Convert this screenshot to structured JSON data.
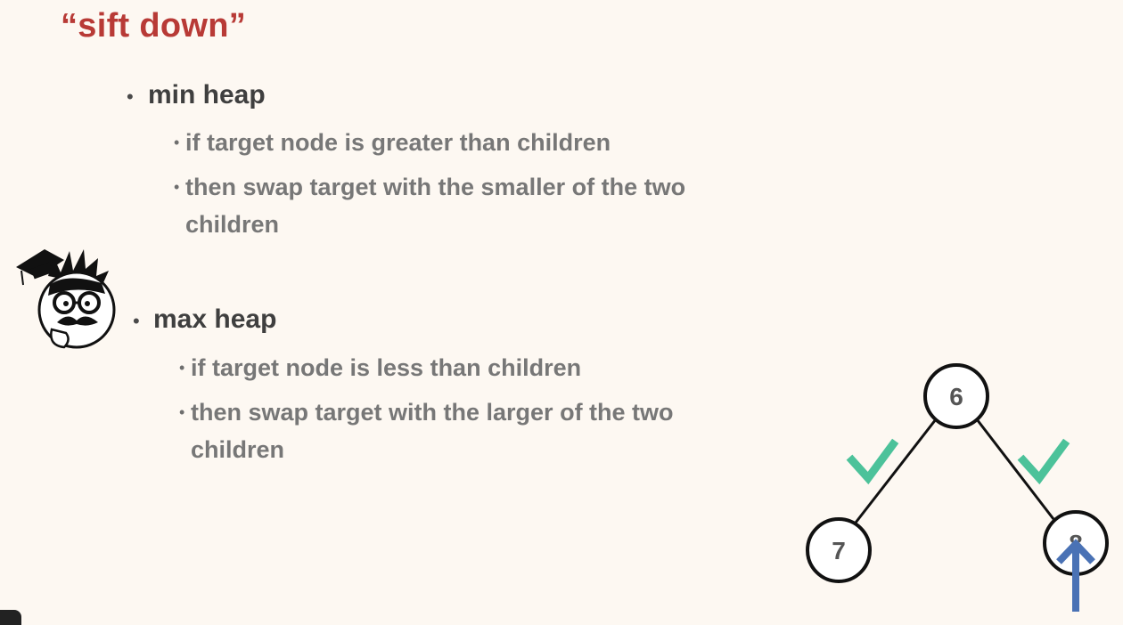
{
  "title": "“sift down”",
  "sections": [
    {
      "heading": "min heap",
      "items": [
        "if target node is greater than children",
        "then swap target with the smaller of the two children"
      ]
    },
    {
      "heading": "max heap",
      "items": [
        "if target node is less than children",
        "then swap target with the larger of the two children"
      ]
    }
  ],
  "tree": {
    "root": "6",
    "left": "7",
    "right": "8"
  },
  "colors": {
    "title": "#b83a36",
    "check": "#4cc29a",
    "arrow": "#4a72b5"
  }
}
